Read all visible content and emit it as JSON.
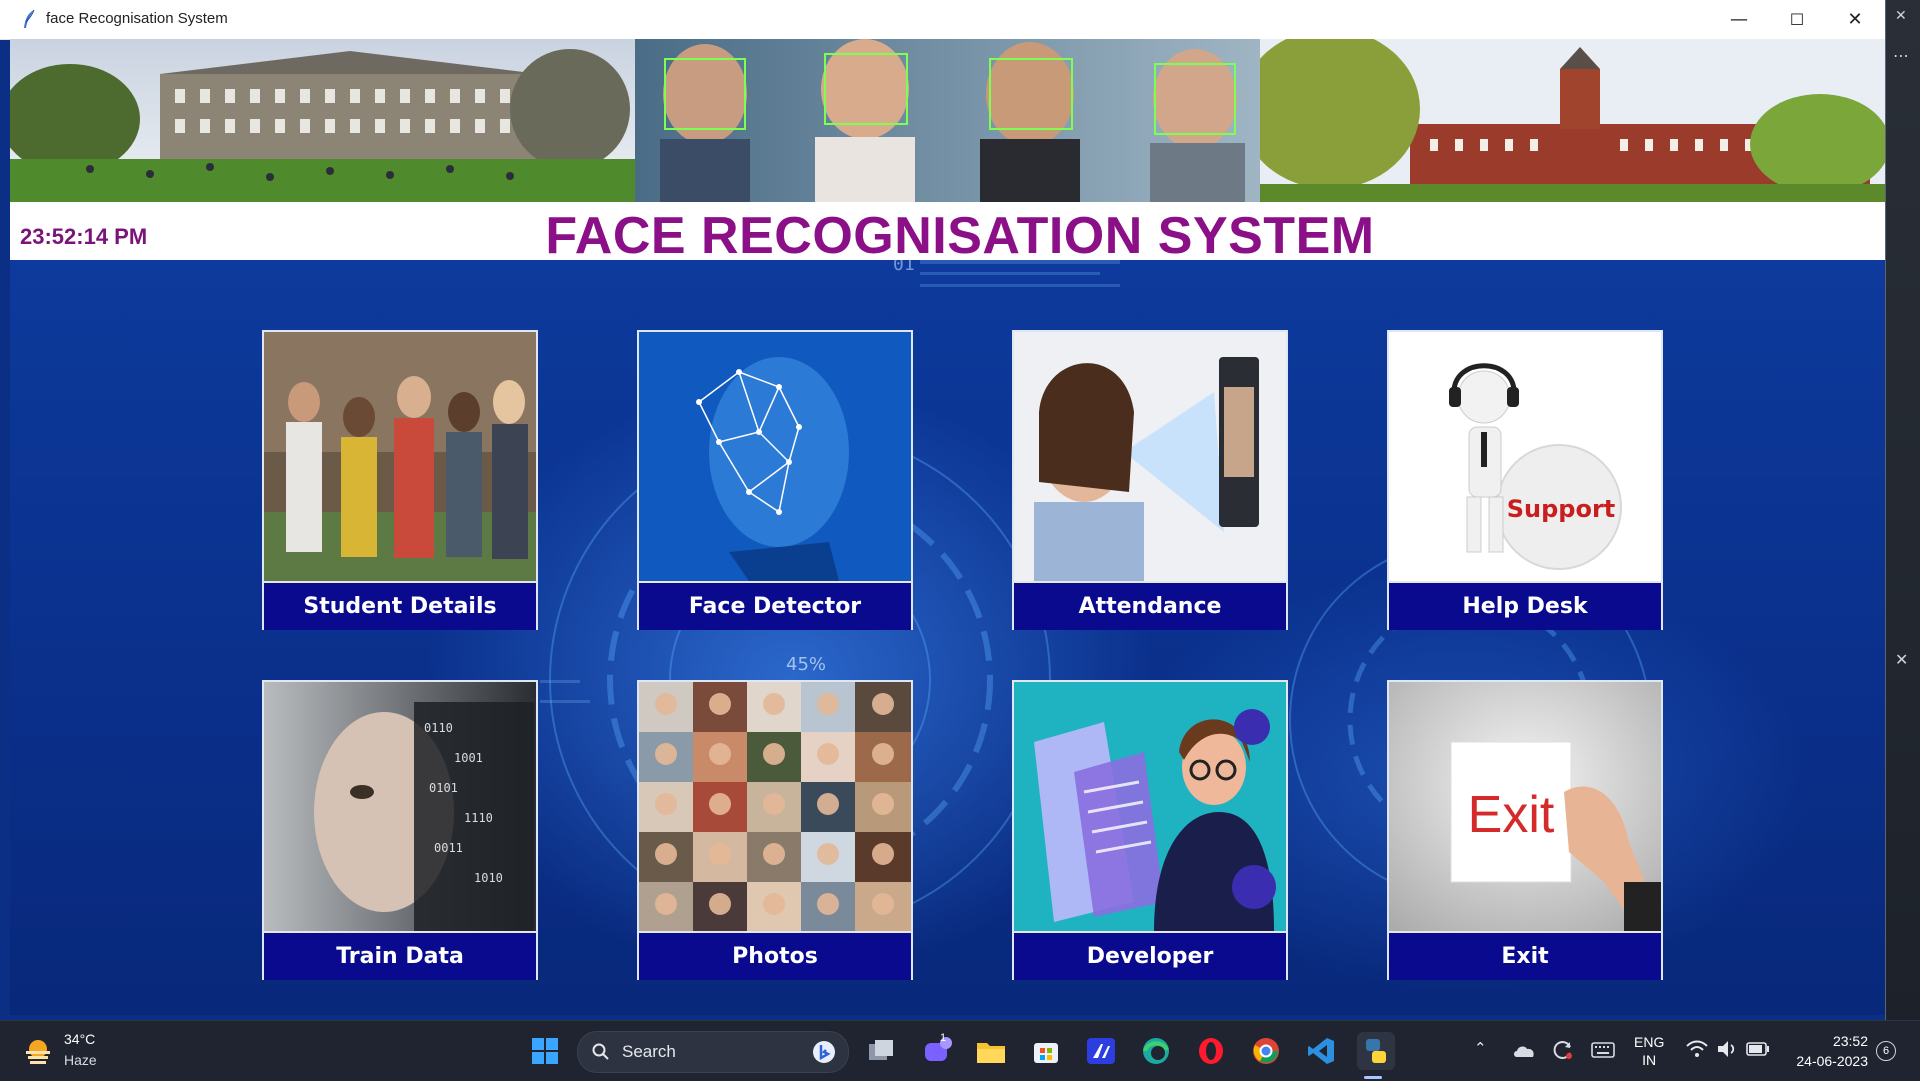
{
  "window": {
    "title": "face Recognisation System",
    "controls": {
      "minimize": "—",
      "maximize": "☐",
      "close": "✕"
    }
  },
  "header": {
    "clock": "23:52:14 PM",
    "title": "FACE RECOGNISATION SYSTEM"
  },
  "tiles": [
    {
      "label": "Student Details",
      "icon": "students-group-photo"
    },
    {
      "label": "Face Detector",
      "icon": "face-mesh-photo"
    },
    {
      "label": "Attendance",
      "icon": "face-scanner-photo"
    },
    {
      "label": "Help Desk",
      "icon": "support-figure-photo",
      "image_text": "Support"
    },
    {
      "label": "Train Data",
      "icon": "digital-face-photo"
    },
    {
      "label": "Photos",
      "icon": "portrait-grid-photo"
    },
    {
      "label": "Developer",
      "icon": "developer-illustration"
    },
    {
      "label": "Exit",
      "icon": "exit-card-photo",
      "image_text": "Exit"
    }
  ],
  "background_text": {
    "code": "01",
    "percent": "45%"
  },
  "taskbar": {
    "weather": {
      "temp": "34°C",
      "desc": "Haze"
    },
    "search_placeholder": "Search",
    "chat_badge": "1",
    "language": {
      "line1": "ENG",
      "line2": "IN"
    },
    "clock": {
      "time": "23:52",
      "date": "24-06-2023"
    },
    "notifications": "6"
  },
  "colors": {
    "title": "#8b0f86",
    "clock": "#7b1479",
    "tile_label_bg": "#0a0a8f",
    "main_bg": "#0c2f86"
  }
}
